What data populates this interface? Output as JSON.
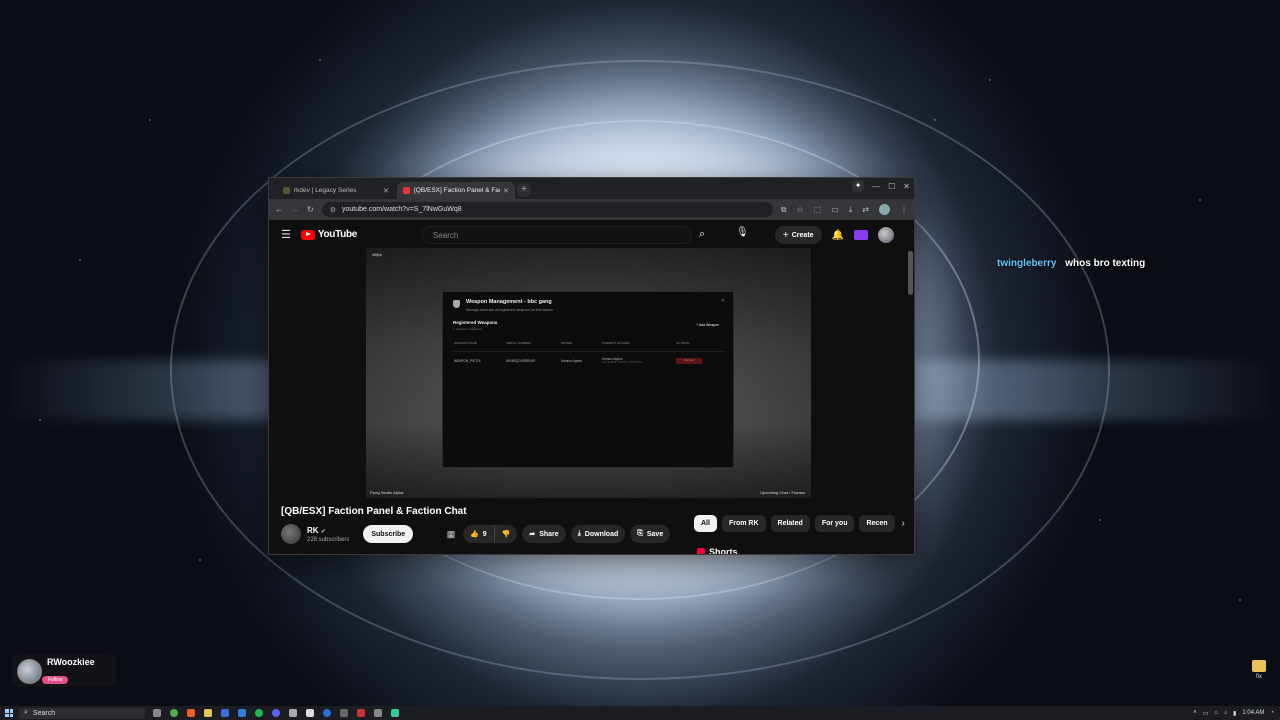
{
  "chat": {
    "user": "twingleberry",
    "message": "whos bro texting"
  },
  "streamer": {
    "name": "RWoozkiee",
    "follow_label": "Follow"
  },
  "desktop_file": {
    "label": "fix"
  },
  "browser": {
    "tabs": [
      {
        "title": "rkdev | Legacy Series",
        "active": false
      },
      {
        "title": "[QB/ESX] Faction Panel & Facti",
        "active": true
      }
    ],
    "new_tab": "+",
    "url": "youtube.com/watch?v=S_7lNwGuWq8"
  },
  "youtube": {
    "logo_text": "YouTube",
    "search_placeholder": "Search",
    "create_label": "Create",
    "video": {
      "corner_tag": "48fps",
      "footer_left": "Fiveg Studio Alpha",
      "footer_right": "Upcoming Chat • Frames"
    },
    "panel": {
      "title": "Weapon Management - bbc gang",
      "subtitle": "Manage and track all registered weapons for this faction",
      "section_title": "Registered Weapons",
      "section_sub": "1 weapons registered",
      "add_label": "Add Weapon",
      "columns": [
        "WEAPON NAME",
        "SERIAL NUMBER",
        "OWNER",
        "CURRENT HOLDER",
        "ACTIONS"
      ],
      "rows": [
        {
          "name": "WEAPON_PISTOL",
          "serial": "60XB0Q24GR8EAR",
          "owner": "Umnum Appse",
          "holder": "Umnum Appse",
          "holder_sub": "Last updated: 13/10/24, 5:15:05 PM",
          "action": "Remove"
        }
      ]
    },
    "title": "[QB/ESX] Faction Panel & Faction Chat",
    "channel": {
      "name": "RK",
      "subscribers": "228 subscribers",
      "subscribe_label": "Subscribe"
    },
    "likes": "9",
    "share_label": "Share",
    "download_label": "Download",
    "save_label": "Save",
    "chips": [
      "All",
      "From RK",
      "Related",
      "For you",
      "Recen"
    ],
    "shorts_label": "Shorts",
    "more_label": "..."
  },
  "taskbar": {
    "search_placeholder": "Search",
    "time": "1:04 AM"
  }
}
